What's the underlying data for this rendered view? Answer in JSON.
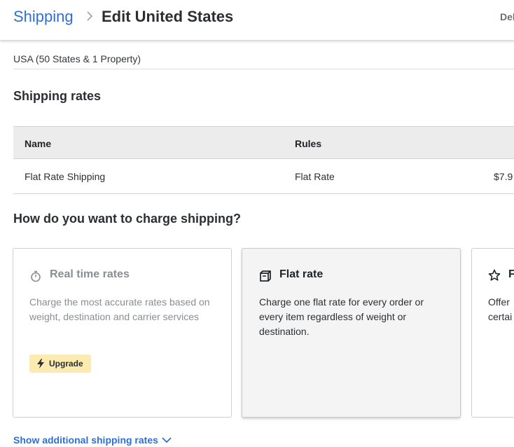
{
  "header": {
    "breadcrumb_link": "Shipping",
    "title": "Edit United States",
    "delete_label": "Delete"
  },
  "zone": {
    "description": "USA (50 States & 1 Property)"
  },
  "shipping_rates": {
    "title": "Shipping rates",
    "columns": [
      "Name",
      "Rules",
      ""
    ],
    "rows": [
      {
        "name": "Flat Rate Shipping",
        "rule": "Flat Rate",
        "price": "$7.9"
      }
    ]
  },
  "charge_section": {
    "title": "How do you want to charge shipping?",
    "options": [
      {
        "title": "Real time rates",
        "description": "Charge the most accurate rates based on weight, destination and carrier services",
        "icon": "stopwatch-icon",
        "state": "disabled",
        "badge": "Upgrade"
      },
      {
        "title": "Flat rate",
        "description": "Charge one flat rate for every order or every item regardless of weight or destination.",
        "icon": "box-icon",
        "state": "selected"
      },
      {
        "title": "F",
        "description": "Offer\ncertai",
        "icon": "star-icon",
        "state": "default"
      }
    ]
  },
  "footer": {
    "show_more_label": "Show additional shipping rates"
  },
  "colors": {
    "link_blue": "#2f6fd6",
    "upgrade_badge": "#fcebb0",
    "table_header": "#ececec"
  }
}
